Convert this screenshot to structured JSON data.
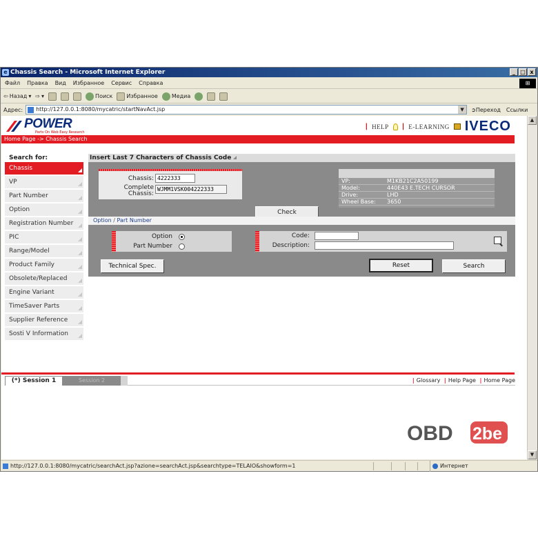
{
  "window": {
    "title": "Chassis Search - Microsoft Internet Explorer",
    "buttons": [
      "_",
      "□",
      "x"
    ]
  },
  "menubar": [
    "Файл",
    "Правка",
    "Вид",
    "Избранное",
    "Сервис",
    "Справка"
  ],
  "toolbar": {
    "back": "Назад",
    "search": "Поиск",
    "favorites": "Избранное",
    "media": "Медиа"
  },
  "address": {
    "label": "Адрес:",
    "url": "http://127.0.0.1:8080/mycatric/startNavAct.jsp",
    "go": "Переход",
    "links": "Ссылки"
  },
  "header": {
    "logo": "POWER",
    "logo_tagline": "Parts On Web Easy Research",
    "help": "HELP",
    "elearning": "E-LEARNING",
    "brand": "IVECO",
    "breadcrumb": "Home Page -> Chassis Search"
  },
  "sidebar": {
    "heading": "Search for:",
    "items": [
      {
        "label": "Chassis",
        "active": true
      },
      {
        "label": "VP"
      },
      {
        "label": "Part Number"
      },
      {
        "label": "Option"
      },
      {
        "label": "Registration Number"
      },
      {
        "label": "PIC"
      },
      {
        "label": "Range/Model"
      },
      {
        "label": "Product Family"
      },
      {
        "label": "Obsolete/Replaced"
      },
      {
        "label": "Engine Variant"
      },
      {
        "label": "TimeSaver Parts"
      },
      {
        "label": "Supplier Reference"
      },
      {
        "label": "Sosti V Information"
      }
    ]
  },
  "main": {
    "heading": "Insert Last 7 Characters of Chassis Code",
    "chassis_label": "Chassis:",
    "chassis_value": "4222333",
    "complete_label_1": "Complete",
    "complete_label_2": "Chassis:",
    "complete_value": "WJMM1VSK004222333",
    "check_button": "Check",
    "vehicle": [
      {
        "key": "VP:",
        "value": "M1KB21C2A50199"
      },
      {
        "key": "Model:",
        "value": "440E43 E.TECH CURSOR"
      },
      {
        "key": "Drive:",
        "value": "LHD"
      },
      {
        "key": "Wheel Base:",
        "value": "3650"
      }
    ],
    "option_link": "Option",
    "part_link": "Part Number",
    "radio_option": "Option",
    "radio_part": "Part Number",
    "code_label": "Code:",
    "description_label": "Description:",
    "code_value": "",
    "description_value": "",
    "tech_button": "Technical Spec.",
    "reset_button": "Reset",
    "search_button": "Search"
  },
  "tabs": {
    "session1": "(*) Session 1",
    "session2": "Session 2",
    "glossary": "Glossary",
    "help_page": "Help Page",
    "home_page": "Home Page"
  },
  "status": {
    "url": "http://127.0.0.1:8080/mycatric/searchAct.jsp?azione=searchAct.jsp&searchtype=TELAIO&showform=1",
    "zone": "Интернет"
  },
  "watermark": "OBD2be",
  "colors": {
    "accent": "#e31c23",
    "brand_blue": "#0a2a7a",
    "panel_grey": "#8a8a8a"
  }
}
